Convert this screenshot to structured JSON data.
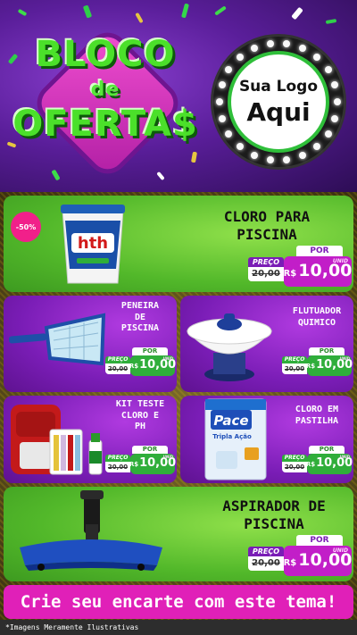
{
  "header": {
    "title_line1": "BLOCO",
    "title_line2": "de",
    "title_line3": "OFERTA$",
    "logo_line1": "Sua Logo",
    "logo_line2": "Aqui"
  },
  "products": [
    {
      "name_line1": "CLORO PARA",
      "name_line2": "PISCINA",
      "discount": "-50%",
      "preco_label": "PREÇO",
      "por_label": "POR",
      "old_price": "20,00",
      "currency": "R$",
      "new_price": "10,00",
      "unit": "UNID",
      "product_icon": "chlorine-bucket-icon"
    },
    {
      "name_line1": "PENEIRA",
      "name_line2": "DE",
      "name_line3": "PISCINA",
      "preco_label": "PREÇO",
      "por_label": "POR",
      "old_price": "20,00",
      "currency": "R$",
      "new_price": "10,00",
      "unit": "UNID",
      "product_icon": "pool-skimmer-net-icon"
    },
    {
      "name_line1": "FLUTUADOR",
      "name_line2": "QUIMICO",
      "preco_label": "PREÇO",
      "por_label": "POR",
      "old_price": "20,00",
      "currency": "R$",
      "new_price": "10,00",
      "unit": "UNID",
      "product_icon": "chemical-floater-icon"
    },
    {
      "name_line1": "KIT TESTE",
      "name_line2": "CLORO E",
      "name_line3": "PH",
      "preco_label": "PREÇO",
      "por_label": "POR",
      "old_price": "20,00",
      "currency": "R$",
      "new_price": "10,00",
      "unit": "UNID",
      "product_icon": "test-kit-icon"
    },
    {
      "name_line1": "CLORO EM",
      "name_line2": "PASTILHA",
      "preco_label": "PREÇO",
      "por_label": "POR",
      "old_price": "20,00",
      "currency": "R$",
      "new_price": "10,00",
      "unit": "UNID",
      "product_icon": "chlorine-tablets-bag-icon",
      "bag_brand": "Pace",
      "bag_line1": "Tripla Ação"
    },
    {
      "name_line1": "ASPIRADOR DE",
      "name_line2": "PISCINA",
      "preco_label": "PREÇO",
      "por_label": "POR",
      "old_price": "20,00",
      "currency": "R$",
      "new_price": "10,00",
      "unit": "UNID",
      "product_icon": "pool-vacuum-head-icon"
    }
  ],
  "bucket_brand": "hth",
  "footer": {
    "banner": "Crie seu encarte com este tema!",
    "disclaimer": "*Imagens Meramente Ilustrativas"
  },
  "colors": {
    "green": "#52b82a",
    "purple": "#7a1db6",
    "magenta": "#e020b8"
  }
}
